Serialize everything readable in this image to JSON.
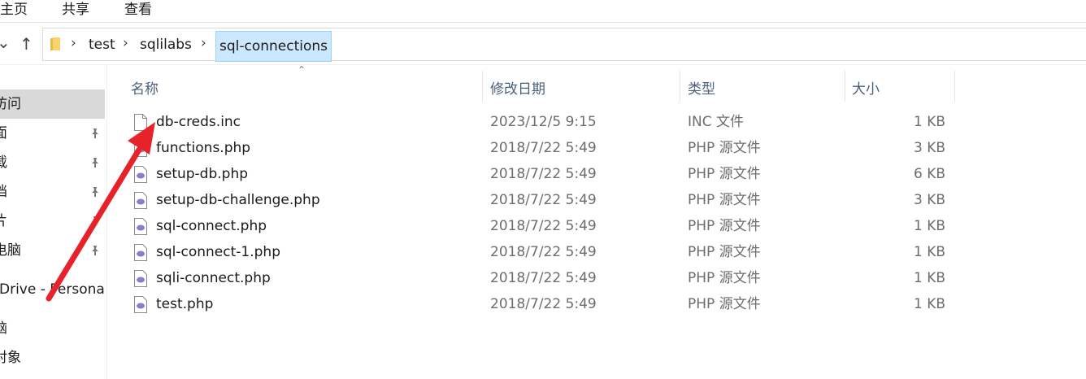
{
  "ribbon": {
    "tabs": [
      "主页",
      "共享",
      "查看"
    ]
  },
  "nav": {
    "expand_glyph": "⌄",
    "up_glyph": "↑"
  },
  "breadcrumb": {
    "items": [
      "test",
      "sqlilabs",
      "sql-connections"
    ],
    "separator": "›"
  },
  "sidebar": {
    "items": [
      {
        "label": "访问",
        "pinned": false,
        "selected": true
      },
      {
        "label": "面",
        "pinned": true
      },
      {
        "label": "载",
        "pinned": true
      },
      {
        "label": "档",
        "pinned": true
      },
      {
        "label": "片",
        "pinned": true
      },
      {
        "label": "电脑",
        "pinned": true
      },
      {
        "label": "Drive - Personal",
        "pinned": false
      },
      {
        "label": "脑",
        "pinned": false
      },
      {
        "label": "对象",
        "pinned": false
      }
    ],
    "pin_glyph": "📌"
  },
  "columns": {
    "name": "名称",
    "date": "修改日期",
    "type": "类型",
    "size": "大小",
    "sort_glyph": "⌃"
  },
  "files": [
    {
      "name": "db-creds.inc",
      "date": "2023/12/5 9:15",
      "type": "INC 文件",
      "size": "1 KB",
      "icon": "generic-file-icon"
    },
    {
      "name": "functions.php",
      "date": "2018/7/22 5:49",
      "type": "PHP 源文件",
      "size": "3 KB",
      "icon": "php-file-icon"
    },
    {
      "name": "setup-db.php",
      "date": "2018/7/22 5:49",
      "type": "PHP 源文件",
      "size": "6 KB",
      "icon": "php-file-icon"
    },
    {
      "name": "setup-db-challenge.php",
      "date": "2018/7/22 5:49",
      "type": "PHP 源文件",
      "size": "3 KB",
      "icon": "php-file-icon"
    },
    {
      "name": "sql-connect.php",
      "date": "2018/7/22 5:49",
      "type": "PHP 源文件",
      "size": "1 KB",
      "icon": "php-file-icon"
    },
    {
      "name": "sql-connect-1.php",
      "date": "2018/7/22 5:49",
      "type": "PHP 源文件",
      "size": "1 KB",
      "icon": "php-file-icon"
    },
    {
      "name": "sqli-connect.php",
      "date": "2018/7/22 5:49",
      "type": "PHP 源文件",
      "size": "1 KB",
      "icon": "php-file-icon"
    },
    {
      "name": "test.php",
      "date": "2018/7/22 5:49",
      "type": "PHP 源文件",
      "size": "1 KB",
      "icon": "php-file-icon"
    }
  ],
  "colors": {
    "annotation_arrow": "#e8222a",
    "selection": "#cce8ff",
    "header_text": "#4c607a"
  }
}
